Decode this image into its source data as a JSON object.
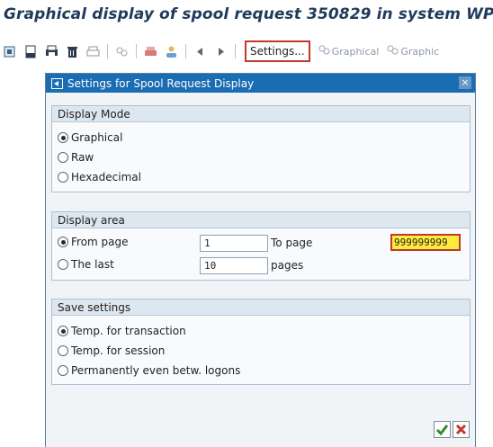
{
  "window": {
    "title": "Graphical display of spool request 350829 in system WP1"
  },
  "toolbar": {
    "settings_label": "Settings...",
    "graphical_label_1": "Graphical",
    "graphical_label_2": "Graphic"
  },
  "dialog": {
    "title": "Settings for Spool Request Display",
    "close_label": "×",
    "display_mode": {
      "title": "Display Mode",
      "options": [
        {
          "label": "Graphical",
          "selected": true
        },
        {
          "label": "Raw",
          "selected": false
        },
        {
          "label": "Hexadecimal",
          "selected": false
        }
      ]
    },
    "display_area": {
      "title": "Display area",
      "from_page_label": "From page",
      "from_page_value": "1",
      "to_page_label": "To page",
      "to_page_value": "999999999",
      "the_last_label": "The last",
      "the_last_value": "10",
      "pages_label": "pages",
      "from_selected": true
    },
    "save_settings": {
      "title": "Save settings",
      "options": [
        {
          "label": "Temp. for transaction",
          "selected": true
        },
        {
          "label": "Temp. for session",
          "selected": false
        },
        {
          "label": "Permanently even betw. logons",
          "selected": false
        }
      ]
    }
  },
  "colors": {
    "dialog_header": "#1a6cb3",
    "highlight_border": "#c0392b",
    "highlight_fill": "#ffeb3b",
    "ok_green": "#2e8b2e",
    "cancel_red": "#c0392b"
  },
  "icons": {
    "toolbar": [
      "refresh-icon",
      "document-icon",
      "print-icon",
      "delete-icon",
      "print-preview-icon",
      "graphical-icon",
      "color-print-icon",
      "user-icon",
      "previous-icon",
      "next-icon"
    ]
  }
}
